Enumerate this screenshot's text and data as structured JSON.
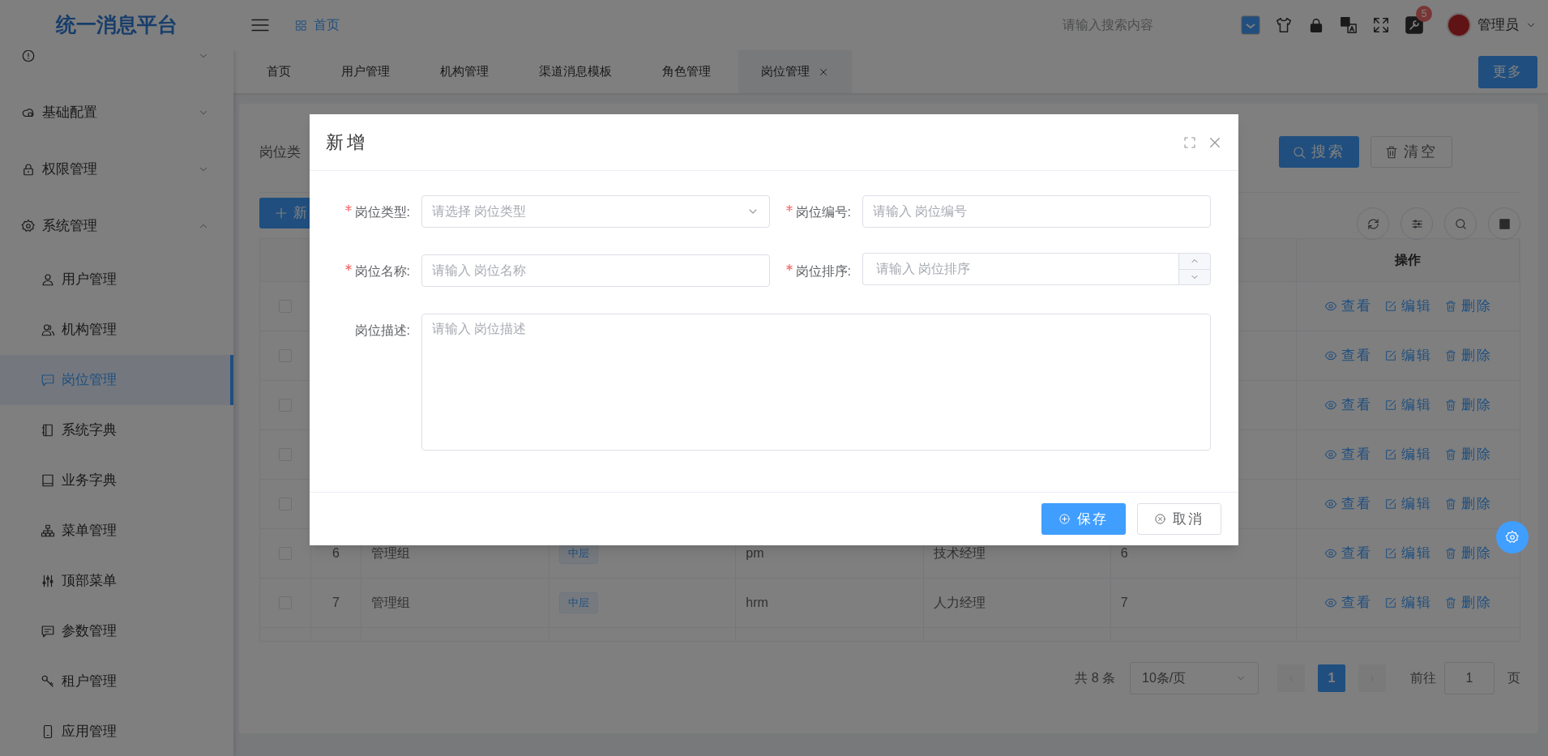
{
  "header": {
    "logo": "统一消息平台",
    "breadcrumb": "首页",
    "search": {
      "placeholder": "请输入搜索内容"
    },
    "notification_count": "5",
    "user": "管理员"
  },
  "tabs": [
    {
      "label": "首页",
      "selected": false
    },
    {
      "label": "用户管理",
      "selected": false
    },
    {
      "label": "机构管理",
      "selected": false
    },
    {
      "label": "渠道消息模板",
      "selected": false
    },
    {
      "label": "角色管理",
      "selected": false
    },
    {
      "label": "岗位管理",
      "selected": true
    }
  ],
  "more_button": "更多",
  "sidebar": {
    "items": [
      {
        "expanded": false
      },
      {
        "label": "基础配置",
        "expanded": false
      },
      {
        "label": "权限管理",
        "expanded": false
      },
      {
        "label": "系统管理",
        "expanded": true,
        "children": [
          {
            "label": "用户管理",
            "selected": false
          },
          {
            "label": "机构管理",
            "selected": false
          },
          {
            "label": "岗位管理",
            "selected": true
          },
          {
            "label": "系统字典",
            "selected": false
          },
          {
            "label": "业务字典",
            "selected": false
          },
          {
            "label": "菜单管理",
            "selected": false
          },
          {
            "label": "顶部菜单",
            "selected": false
          },
          {
            "label": "参数管理",
            "selected": false
          },
          {
            "label": "租户管理",
            "selected": false
          },
          {
            "label": "应用管理",
            "selected": false
          }
        ]
      }
    ]
  },
  "search_form": {
    "label": "岗位类",
    "buttons": [
      {
        "label": "搜索",
        "kind": "primary"
      },
      {
        "label": "清空",
        "kind": "default"
      }
    ]
  },
  "add_button": "新",
  "table": {
    "action_column": "操作",
    "rows": [
      {
        "checked": false,
        "actions": [
          "查看",
          "编辑",
          "删除"
        ]
      },
      {
        "checked": false,
        "actions": [
          "查看",
          "编辑",
          "删除"
        ]
      },
      {
        "checked": false,
        "actions": [
          "查看",
          "编辑",
          "删除"
        ]
      },
      {
        "checked": false,
        "actions": [
          "查看",
          "编辑",
          "删除"
        ]
      },
      {
        "checked": false,
        "actions": [
          "查看",
          "编辑",
          "删除"
        ]
      },
      {
        "checked": false,
        "no": "6",
        "group": "管理组",
        "tier": "中层",
        "code": "pm",
        "name": "技术经理",
        "sort": "6",
        "actions": [
          "查看",
          "编辑",
          "删除"
        ]
      },
      {
        "checked": false,
        "no": "7",
        "group": "管理组",
        "tier": "中层",
        "code": "hrm",
        "name": "人力经理",
        "sort": "7",
        "actions": [
          "查看",
          "编辑",
          "删除"
        ]
      }
    ]
  },
  "pagination": {
    "total": "共 8 条",
    "page_size": "10条/页",
    "pages": [
      {
        "label": "1",
        "selected": true
      }
    ],
    "goto_label": "前往",
    "goto_value": "1",
    "page_suffix": "页"
  },
  "dialog": {
    "title": "新增",
    "fields": [
      {
        "label": "岗位类型:",
        "required": true,
        "kind": "select",
        "placeholder": "请选择 岗位类型"
      },
      {
        "label": "岗位编号:",
        "required": true,
        "kind": "input",
        "placeholder": "请输入 岗位编号"
      },
      {
        "label": "岗位名称:",
        "required": true,
        "kind": "input",
        "placeholder": "请输入 岗位名称"
      },
      {
        "label": "岗位排序:",
        "required": true,
        "kind": "number",
        "placeholder": "请输入 岗位排序"
      },
      {
        "label": "岗位描述:",
        "required": false,
        "kind": "textarea",
        "placeholder": "请输入 岗位描述"
      }
    ],
    "buttons": [
      {
        "label": "保存",
        "kind": "primary"
      },
      {
        "label": "取消",
        "kind": "default"
      }
    ]
  }
}
